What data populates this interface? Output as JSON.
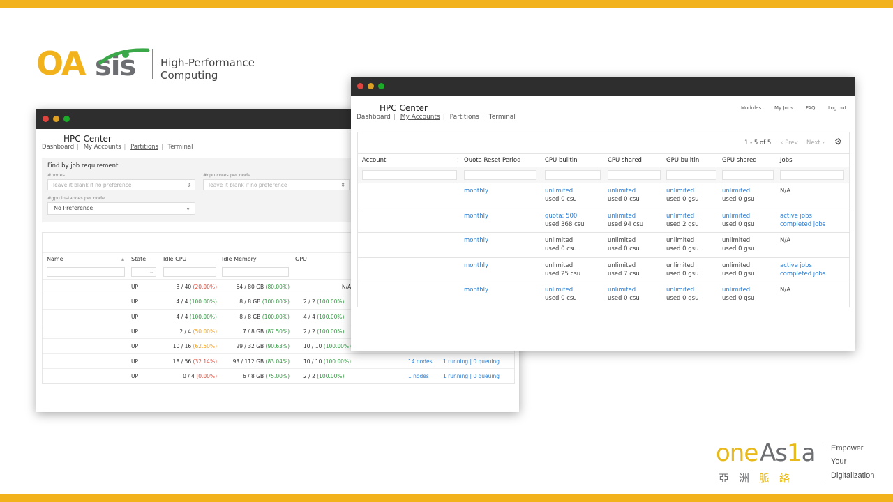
{
  "brand": {
    "oasis_oa": "OA",
    "oasis_sis": "sis",
    "tagline": "High-Performance Computing",
    "oneasia_one": "oneAs",
    "oneasia_i": "1",
    "oneasia_a": "a",
    "oneasia_chinese": [
      "亞",
      "洲",
      "脈",
      "絡"
    ],
    "slogan": [
      "Empower",
      "Your",
      "Digitalization"
    ]
  },
  "colors": {
    "accent_yellow": "#f2b21c",
    "logo_gray": "#6d6e71",
    "link_blue": "#2a7fd4",
    "good_green": "#2e9e3e",
    "bad_red": "#e04a3a",
    "warn_orange": "#f0a020"
  },
  "partitions_window": {
    "title": "HPC Center",
    "nav": [
      "Dashboard",
      "My Accounts",
      "Partitions",
      "Terminal"
    ],
    "active_nav": "Partitions",
    "find": {
      "title": "Find by job requirement",
      "nodes_label": "#nodes",
      "nodes_placeholder": "leave it blank if no preference",
      "cores_label": "#cpu cores per node",
      "cores_placeholder": "leave it blank if no preference",
      "gpu_label": "#gpu instances per node",
      "gpu_value": "No Preference"
    },
    "columns": [
      "Name",
      "State",
      "Idle CPU",
      "Idle Memory",
      "GPU"
    ],
    "rows": [
      {
        "state": "UP",
        "cpu": "8 / 40",
        "cpu_pct": "(20.00%)",
        "cpu_c": "red",
        "mem": "64 / 80 GB",
        "mem_pct": "(80.00%)",
        "mem_c": "green",
        "gpu": "N/A",
        "gpu_pct": "",
        "gpu_c": "",
        "nodes": "",
        "jobs": ""
      },
      {
        "state": "UP",
        "cpu": "4 / 4",
        "cpu_pct": "(100.00%)",
        "cpu_c": "green",
        "mem": "8 / 8 GB",
        "mem_pct": "(100.00%)",
        "mem_c": "green",
        "gpu": "2 / 2",
        "gpu_pct": "(100.00%)",
        "gpu_c": "green",
        "nodes": "",
        "jobs": ""
      },
      {
        "state": "UP",
        "cpu": "4 / 4",
        "cpu_pct": "(100.00%)",
        "cpu_c": "green",
        "mem": "8 / 8 GB",
        "mem_pct": "(100.00%)",
        "mem_c": "green",
        "gpu": "4 / 4",
        "gpu_pct": "(100.00%)",
        "gpu_c": "green",
        "nodes": "",
        "jobs": ""
      },
      {
        "state": "UP",
        "cpu": "2 / 4",
        "cpu_pct": "(50.00%)",
        "cpu_c": "orange",
        "mem": "7 / 8 GB",
        "mem_pct": "(87.50%)",
        "mem_c": "green",
        "gpu": "2 / 2",
        "gpu_pct": "(100.00%)",
        "gpu_c": "green",
        "nodes": "",
        "jobs": ""
      },
      {
        "state": "UP",
        "cpu": "10 / 16",
        "cpu_pct": "(62.50%)",
        "cpu_c": "orange",
        "mem": "29 / 32 GB",
        "mem_pct": "(90.63%)",
        "mem_c": "green",
        "gpu": "10 / 10",
        "gpu_pct": "(100.00%)",
        "gpu_c": "green",
        "nodes": "",
        "jobs": ""
      },
      {
        "state": "UP",
        "cpu": "18 / 56",
        "cpu_pct": "(32.14%)",
        "cpu_c": "red",
        "mem": "93 / 112 GB",
        "mem_pct": "(83.04%)",
        "mem_c": "green",
        "gpu": "10 / 10",
        "gpu_pct": "(100.00%)",
        "gpu_c": "green",
        "nodes": "14 nodes",
        "jobs": "1 running | 0 queuing"
      },
      {
        "state": "UP",
        "cpu": "0 / 4",
        "cpu_pct": "(0.00%)",
        "cpu_c": "red",
        "mem": "6 / 8 GB",
        "mem_pct": "(75.00%)",
        "mem_c": "green",
        "gpu": "2 / 2",
        "gpu_pct": "(100.00%)",
        "gpu_c": "green",
        "nodes": "1 nodes",
        "jobs": "1 running | 0 queuing"
      }
    ]
  },
  "accounts_window": {
    "title": "HPC Center",
    "nav": [
      "Dashboard",
      "My Accounts",
      "Partitions",
      "Terminal"
    ],
    "active_nav": "My Accounts",
    "top_links": [
      "Modules",
      "My Jobs",
      "FAQ",
      "Log out"
    ],
    "pager": {
      "range": "1 - 5 of 5",
      "prev": "‹ Prev",
      "next": "Next ›"
    },
    "columns": [
      "Account",
      "Quota Reset Period",
      "CPU builtin",
      "CPU shared",
      "GPU builtin",
      "GPU shared",
      "Jobs"
    ],
    "rows": [
      {
        "period": "monthly",
        "cpu_b": [
          "unlimited",
          "used 0 csu"
        ],
        "cpu_b_link": true,
        "cpu_s": [
          "unlimited",
          "used 0 csu"
        ],
        "cpu_s_link": true,
        "gpu_b": [
          "unlimited",
          "used 0 gsu"
        ],
        "gpu_b_link": true,
        "gpu_s": [
          "unlimited",
          "used 0 gsu"
        ],
        "gpu_s_link": true,
        "jobs": [
          "N/A",
          ""
        ],
        "jobs_link": false
      },
      {
        "period": "monthly",
        "cpu_b": [
          "quota: 500",
          "used 368 csu"
        ],
        "cpu_b_link": true,
        "cpu_s": [
          "unlimited",
          "used 94 csu"
        ],
        "cpu_s_link": true,
        "gpu_b": [
          "unlimited",
          "used 2 gsu"
        ],
        "gpu_b_link": true,
        "gpu_s": [
          "unlimited",
          "used 0 gsu"
        ],
        "gpu_s_link": true,
        "jobs": [
          "active jobs",
          "completed jobs"
        ],
        "jobs_link": true
      },
      {
        "period": "monthly",
        "cpu_b": [
          "unlimited",
          "used 0 csu"
        ],
        "cpu_b_link": false,
        "cpu_s": [
          "unlimited",
          "used 0 csu"
        ],
        "cpu_s_link": false,
        "gpu_b": [
          "unlimited",
          "used 0 gsu"
        ],
        "gpu_b_link": false,
        "gpu_s": [
          "unlimited",
          "used 0 gsu"
        ],
        "gpu_s_link": false,
        "jobs": [
          "N/A",
          ""
        ],
        "jobs_link": false
      },
      {
        "period": "monthly",
        "cpu_b": [
          "unlimited",
          "used 25 csu"
        ],
        "cpu_b_link": false,
        "cpu_s": [
          "unlimited",
          "used 7 csu"
        ],
        "cpu_s_link": false,
        "gpu_b": [
          "unlimited",
          "used 0 gsu"
        ],
        "gpu_b_link": false,
        "gpu_s": [
          "unlimited",
          "used 0 gsu"
        ],
        "gpu_s_link": false,
        "jobs": [
          "active jobs",
          "completed jobs"
        ],
        "jobs_link": true
      },
      {
        "period": "monthly",
        "cpu_b": [
          "unlimited",
          "used 0 csu"
        ],
        "cpu_b_link": true,
        "cpu_s": [
          "unlimited",
          "used 0 csu"
        ],
        "cpu_s_link": true,
        "gpu_b": [
          "unlimited",
          "used 0 gsu"
        ],
        "gpu_b_link": true,
        "gpu_s": [
          "unlimited",
          "used 0 gsu"
        ],
        "gpu_s_link": true,
        "jobs": [
          "N/A",
          ""
        ],
        "jobs_link": false
      }
    ]
  }
}
